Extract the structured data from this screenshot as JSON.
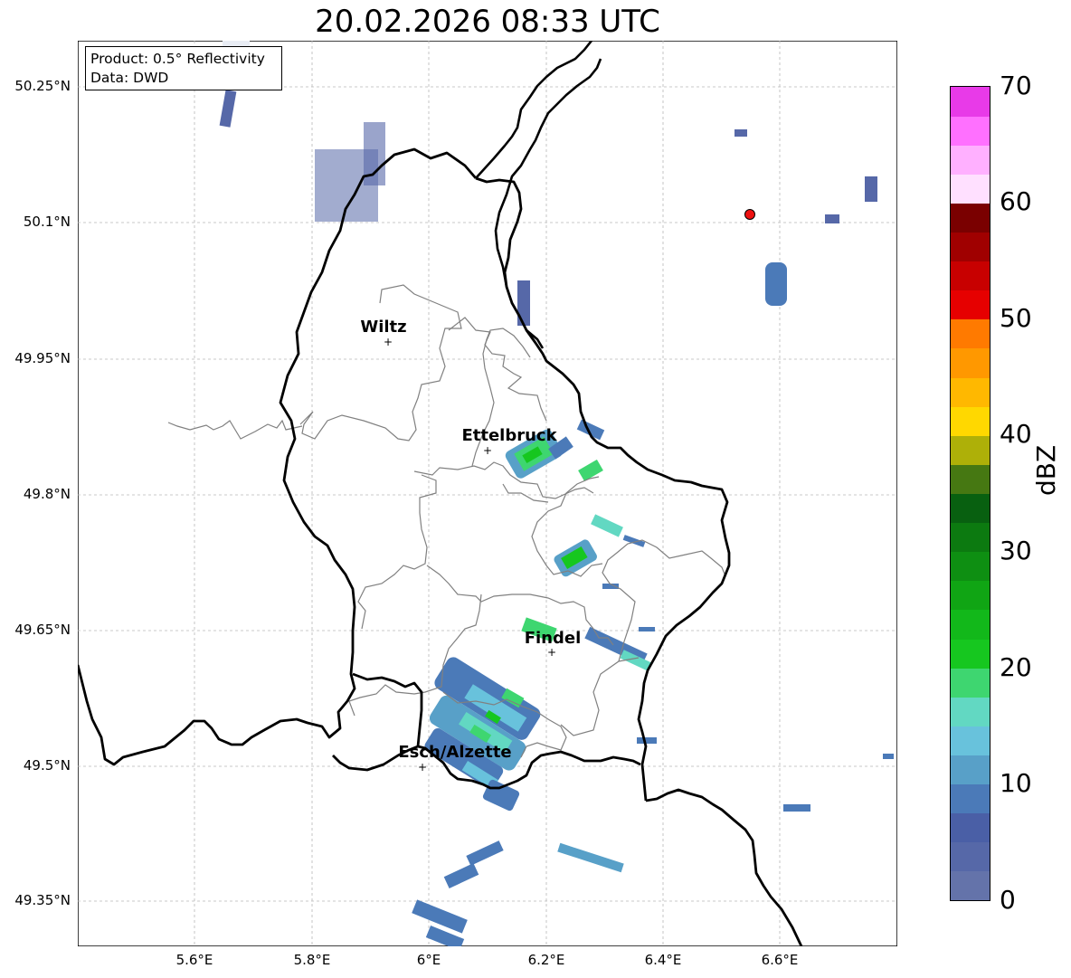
{
  "title": "20.02.2026 08:33 UTC",
  "info": {
    "product": "Product: 0.5° Reflectivity",
    "data": "Data: DWD"
  },
  "lat_labels": [
    "50.25°N",
    "50.1°N",
    "49.95°N",
    "49.8°N",
    "49.65°N",
    "49.5°N",
    "49.35°N"
  ],
  "lon_labels": [
    "5.6°E",
    "5.8°E",
    "6°E",
    "6.2°E",
    "6.4°E",
    "6.6°E"
  ],
  "cities": [
    {
      "name": "Wiltz"
    },
    {
      "name": "Ettelbruck"
    },
    {
      "name": "Findel"
    },
    {
      "name": "Esch/Alzette"
    }
  ],
  "colorbar": {
    "label": "dBZ",
    "ticks": [
      "0",
      "10",
      "20",
      "30",
      "40",
      "50",
      "60",
      "70"
    ],
    "colors": [
      "#6473aa",
      "#5668a8",
      "#4a5fa6",
      "#4b7ab8",
      "#58a0c8",
      "#68c2dc",
      "#62d8c2",
      "#3ed670",
      "#16c71f",
      "#12b81a",
      "#10a514",
      "#0e8f12",
      "#0c7a10",
      "#086010",
      "#467812",
      "#aeb008",
      "#ffd800",
      "#ffb800",
      "#ff9800",
      "#ff7a00",
      "#e60000",
      "#c80000",
      "#a00000",
      "#7a0000",
      "#ffe0ff",
      "#ffb0ff",
      "#ff70ff",
      "#e83ae8"
    ]
  },
  "colors": {
    "radar_site": "#ee1111",
    "border": "#000000",
    "canton_line": "#808080",
    "grid": "#b0b0b0"
  }
}
